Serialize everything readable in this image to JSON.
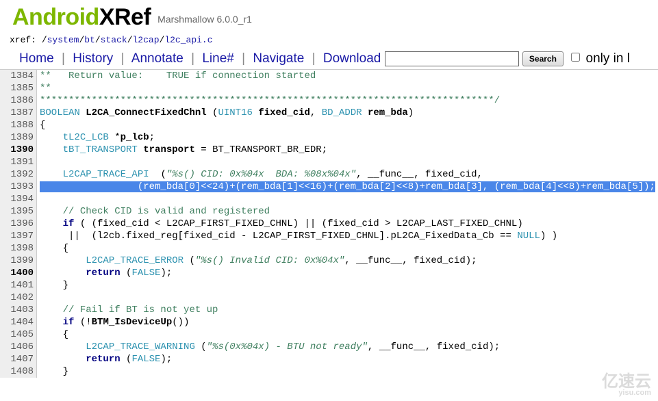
{
  "logo": {
    "part1": "Android",
    "part2": "XRef"
  },
  "subtitle": "Marshmallow 6.0.0_r1",
  "xref_prefix": "xref: ",
  "path_parts": [
    "/",
    "system",
    "/",
    "bt",
    "/",
    "stack",
    "/",
    "l2cap",
    "/",
    "l2c_api.c"
  ],
  "toolbar": {
    "home": "Home",
    "history": "History",
    "annotate": "Annotate",
    "line": "Line#",
    "navigate": "Navigate",
    "download": "Download",
    "search_btn": "Search",
    "only_label": "only in l",
    "search_placeholder": ""
  },
  "lines": [
    {
      "n": 1384,
      "html": "<span class='c0'>**   Return value:    TRUE if connection started</span>"
    },
    {
      "n": 1385,
      "html": "<span class='c0'>**</span>"
    },
    {
      "n": 1386,
      "html": "<span class='c0'>*******************************************************************************/</span>"
    },
    {
      "n": 1387,
      "html": "<span class='tp'>BOOLEAN</span> <span class='fn'>L2CA_ConnectFixedChnl</span> (<span class='tp'>UINT16</span> <span class='fn'>fixed_cid</span>, <span class='tp'>BD_ADDR</span> <span class='fn'>rem_bda</span>)"
    },
    {
      "n": 1388,
      "html": "{"
    },
    {
      "n": 1389,
      "html": "    <span class='tp'>tL2C_LCB</span> *<span class='fn'>p_lcb</span>;"
    },
    {
      "n": 1390,
      "bold": true,
      "html": "    <span class='tp'>tBT_TRANSPORT</span> <span class='fn'>transport</span> = BT_TRANSPORT_BR_EDR;"
    },
    {
      "n": 1391,
      "html": ""
    },
    {
      "n": 1392,
      "html": "    <span class='tp'>L2CAP_TRACE_API</span>  (<span class='str2'>\"%s() CID: 0x%04x  BDA: %08x%04x\"</span>, __func__, fixed_cid,"
    },
    {
      "n": 1393,
      "html": "<span class='hl'>                 (rem_bda[0]&lt;&lt;24)+(rem_bda[1]&lt;&lt;16)+(rem_bda[2]&lt;&lt;8)+rem_bda[3], (rem_bda[4]&lt;&lt;8)+rem_bda[5]);</span>"
    },
    {
      "n": 1394,
      "html": ""
    },
    {
      "n": 1395,
      "html": "    <span class='c0'>// Check CID is valid and registered</span>"
    },
    {
      "n": 1396,
      "html": "    <span class='builtin'>if</span> ( (fixed_cid &lt; L2CAP_FIRST_FIXED_CHNL) || (fixed_cid &gt; L2CAP_LAST_FIXED_CHNL)"
    },
    {
      "n": 1397,
      "html": "     ||  (l2cb.fixed_reg[fixed_cid - L2CAP_FIRST_FIXED_CHNL].pL2CA_FixedData_Cb == <span class='tp'>NULL</span>) )"
    },
    {
      "n": 1398,
      "html": "    {"
    },
    {
      "n": 1399,
      "html": "        <span class='tp'>L2CAP_TRACE_ERROR</span> (<span class='str2'>\"%s() Invalid CID: 0x%04x\"</span>, __func__, fixed_cid);"
    },
    {
      "n": 1400,
      "bold": true,
      "html": "        <span class='builtin'>return</span> (<span class='tp'>FALSE</span>);"
    },
    {
      "n": 1401,
      "html": "    }"
    },
    {
      "n": 1402,
      "html": ""
    },
    {
      "n": 1403,
      "html": "    <span class='c0'>// Fail if BT is not yet up</span>"
    },
    {
      "n": 1404,
      "html": "    <span class='builtin'>if</span> (!<span class='fn'>BTM_IsDeviceUp</span>())"
    },
    {
      "n": 1405,
      "html": "    {"
    },
    {
      "n": 1406,
      "html": "        <span class='tp'>L2CAP_TRACE_WARNING</span> (<span class='str2'>\"%s(0x%04x) - BTU not ready\"</span>, __func__, fixed_cid);"
    },
    {
      "n": 1407,
      "html": "        <span class='builtin'>return</span> (<span class='tp'>FALSE</span>);"
    },
    {
      "n": 1408,
      "html": "    }"
    }
  ],
  "watermark": {
    "main": "亿速云",
    "sub": "yisu.com"
  }
}
